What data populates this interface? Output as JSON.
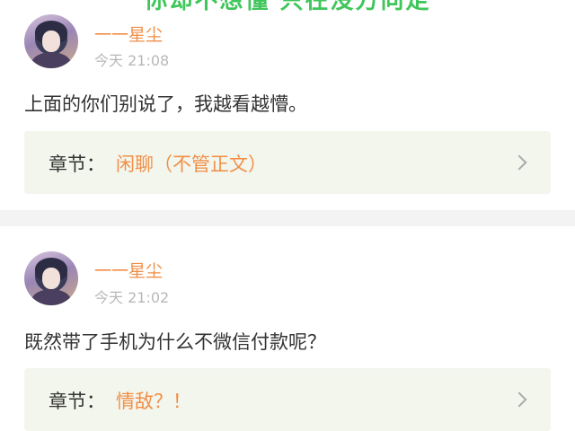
{
  "caption": "你却不想懂 只在没方向走",
  "comments": [
    {
      "username": "一一星尘",
      "time": "今天 21:08",
      "content": "上面的你们别说了，我越看越懵。",
      "chapter_label": "章节：",
      "chapter_name": "闲聊（不管正文）"
    },
    {
      "username": "一一星尘",
      "time": "今天 21:02",
      "content": "既然带了手机为什么不微信付款呢？",
      "chapter_label": "章节：",
      "chapter_name": "情敌？！"
    }
  ],
  "colors": {
    "username": "#f08f47",
    "chapter_bg": "#f3f6ed",
    "caption": "#3fc65a"
  }
}
